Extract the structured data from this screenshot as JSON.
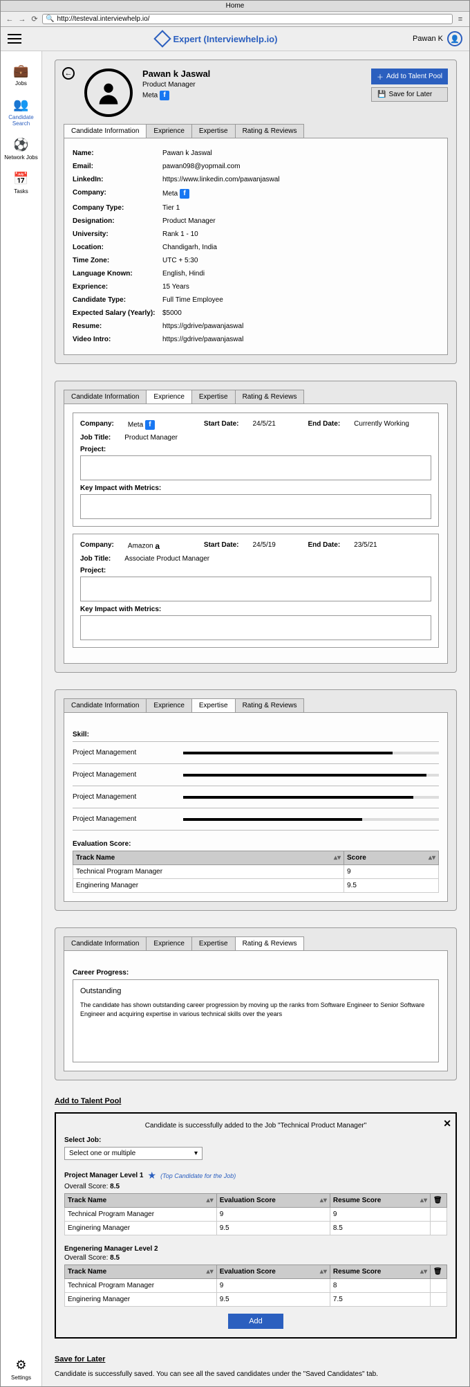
{
  "browser": {
    "title": "Home",
    "url": "http://testeval.interviewhelp.io/"
  },
  "header": {
    "brand": "Expert (Interviewhelp.io)",
    "user": "Pawan K"
  },
  "sidebar": {
    "items": [
      {
        "label": "Jobs",
        "icon": "💼"
      },
      {
        "label": "Candidate Search",
        "icon": "👥"
      },
      {
        "label": "Network Jobs",
        "icon": "⚽"
      },
      {
        "label": "Tasks",
        "icon": "📅"
      }
    ],
    "bottom": {
      "label": "Settings",
      "icon": "⚙"
    }
  },
  "profile": {
    "name": "Pawan k Jaswal",
    "role": "Product Manager",
    "company": "Meta"
  },
  "actions": {
    "add": "Add to Talent Pool",
    "save": "Save for Later"
  },
  "tabStrip": [
    "Candidate Information",
    "Exprience",
    "Expertise",
    "Rating & Reviews"
  ],
  "info": [
    {
      "label": "Name:",
      "value": "Pawan k Jaswal"
    },
    {
      "label": "Email:",
      "value": "pawan098@yopmail.com"
    },
    {
      "label": "LinkedIn:",
      "value": "https://www.linkedin.com/pawanjaswal"
    },
    {
      "label": "Company:",
      "value": "Meta",
      "fb": true
    },
    {
      "label": "Company Type:",
      "value": "Tier 1"
    },
    {
      "label": "Designation:",
      "value": "Product Manager"
    },
    {
      "label": "University:",
      "value": "Rank 1 - 10"
    },
    {
      "label": "Location:",
      "value": "Chandigarh, India"
    },
    {
      "label": "Time Zone:",
      "value": "UTC + 5:30"
    },
    {
      "label": "Language Known:",
      "value": "English, Hindi"
    },
    {
      "label": "Exprience:",
      "value": "15 Years"
    },
    {
      "label": "Candidate Type:",
      "value": "Full Time Employee"
    },
    {
      "label": "Expected Salary (Yearly):",
      "value": "$5000"
    },
    {
      "label": "Resume:",
      "value": "https://gdrive/pawanjaswal"
    },
    {
      "label": "Video Intro:",
      "value": "https://gdrive/pawanjaswal"
    }
  ],
  "experience": [
    {
      "company": "Meta",
      "icon": "fb",
      "startLabel": "Start Date:",
      "start": "24/5/21",
      "endLabel": "End Date:",
      "end": "Currently Working",
      "titleLabel": "Job Title:",
      "title": "Product Manager",
      "projectLabel": "Project:",
      "impactLabel": "Key Impact with Metrics:"
    },
    {
      "company": "Amazon",
      "icon": "amz",
      "startLabel": "Start Date:",
      "start": "24/5/19",
      "endLabel": "End Date:",
      "end": "23/5/21",
      "titleLabel": "Job Title:",
      "title": "Associate Product Manager",
      "projectLabel": "Project:",
      "impactLabel": "Key Impact with Metrics:"
    }
  ],
  "expLabels": {
    "company": "Company:"
  },
  "expertise": {
    "skillLabel": "Skill:",
    "skills": [
      {
        "name": "Project Management",
        "pct": 82
      },
      {
        "name": "Project Management",
        "pct": 95
      },
      {
        "name": "Project Management",
        "pct": 90
      },
      {
        "name": "Project Management",
        "pct": 70
      }
    ],
    "evalLabel": "Evaluation Score:",
    "evalCols": [
      "Track Name",
      "Score"
    ],
    "evalRows": [
      {
        "track": "Technical Program Manager",
        "score": "9"
      },
      {
        "track": "Enginering Manager",
        "score": "9.5"
      }
    ]
  },
  "rating": {
    "careerLabel": "Career Progress:",
    "headline": "Outstanding",
    "body": "The candidate has shown outstanding career progression by moving up the ranks from Software Engineer to Senior Software Engineer and acquiring expertise in various technical skills over the years"
  },
  "talent": {
    "heading": "Add to Talent Pool",
    "success": "Candidate is successfully added to the Job \"Technical Product Manager\"",
    "selectJob": "Select Job:",
    "placeholder": "Select one or multiple",
    "jobs": [
      {
        "name": "Project Manager Level 1",
        "top": true,
        "topLabel": "(Top Candidate for the Job)",
        "overallLabel": "Overall Score:",
        "overall": "8.5",
        "cols": [
          "Track Name",
          "Evaluation Score",
          "Resume Score"
        ],
        "rows": [
          {
            "track": "Technical Program Manager",
            "eval": "9",
            "resume": "9"
          },
          {
            "track": "Enginering Manager",
            "eval": "9.5",
            "resume": "8.5"
          }
        ]
      },
      {
        "name": "Engenering Manager Level 2",
        "top": false,
        "overallLabel": "Overall Score:",
        "overall": "8.5",
        "cols": [
          "Track Name",
          "Evaluation Score",
          "Resume Score"
        ],
        "rows": [
          {
            "track": "Technical Program Manager",
            "eval": "9",
            "resume": "8"
          },
          {
            "track": "Enginering Manager",
            "eval": "9.5",
            "resume": "7.5"
          }
        ]
      }
    ],
    "addBtn": "Add"
  },
  "saveLater": {
    "heading": "Save for Later",
    "msg": "Candidate is successfully saved. You can see all the saved candidates under the \"Saved Candidates\" tab."
  }
}
